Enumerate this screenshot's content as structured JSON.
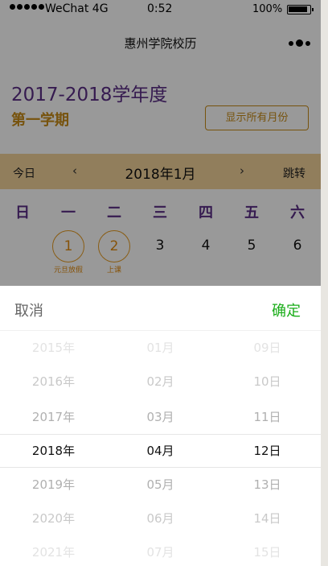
{
  "status_bar": {
    "carrier": "WeChat 4G",
    "time": "0:52",
    "battery_percent": "100%",
    "signal_bars": 5
  },
  "navbar": {
    "title": "惠州学院校历",
    "more_icon": "more-dots-icon"
  },
  "page": {
    "year_title": "2017-2018学年度",
    "semester": "第一学期",
    "show_all_button": "显示所有月份"
  },
  "month_bar": {
    "today_label": "今日",
    "prev_icon": "chevron-left-icon",
    "prev_glyph": "‹",
    "month_label": "2018年1月",
    "next_icon": "chevron-right-icon",
    "next_glyph": "›",
    "jump_label": "跳转"
  },
  "weekdays": [
    "日",
    "一",
    "二",
    "三",
    "四",
    "五",
    "六"
  ],
  "days": [
    {
      "num": "1",
      "note": "元旦放假",
      "circled": true
    },
    {
      "num": "2",
      "note": "上课",
      "circled": true
    },
    {
      "num": "3",
      "note": "",
      "circled": false
    },
    {
      "num": "4",
      "note": "",
      "circled": false
    },
    {
      "num": "5",
      "note": "",
      "circled": false
    },
    {
      "num": "6",
      "note": "",
      "circled": false
    }
  ],
  "picker": {
    "cancel_label": "取消",
    "confirm_label": "确定",
    "years": [
      "2015年",
      "2016年",
      "2017年",
      "2018年",
      "2019年",
      "2020年",
      "2021年"
    ],
    "months": [
      "01月",
      "02月",
      "03月",
      "04月",
      "05月",
      "06月",
      "07月"
    ],
    "dates": [
      "09日",
      "10日",
      "11日",
      "12日",
      "13日",
      "14日",
      "15日"
    ],
    "selected_index": 3
  },
  "colors": {
    "purple": "#5a2d86",
    "gold": "#c78a17",
    "month_bar_bg": "#f2d29a",
    "confirm_green": "#1aad19"
  }
}
